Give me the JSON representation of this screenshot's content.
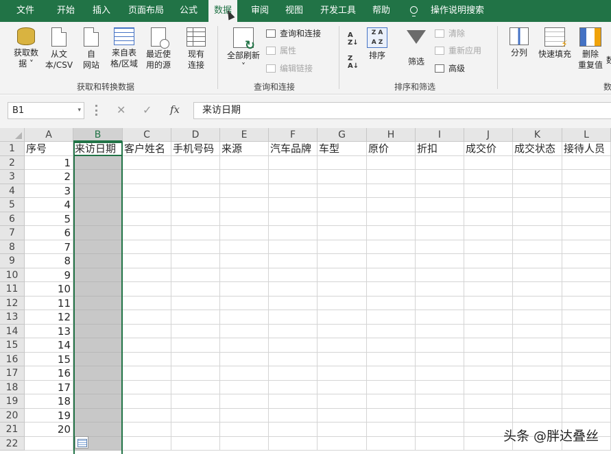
{
  "tabs": {
    "file": "文件",
    "home": "开始",
    "insert": "插入",
    "layout": "页面布局",
    "formulas": "公式",
    "data": "数据",
    "review": "审阅",
    "view": "视图",
    "developer": "开发工具",
    "help": "帮助",
    "tell_me": "操作说明搜索"
  },
  "ribbon": {
    "get_data_1": "获取数",
    "get_data_2": "据 ˅",
    "from_text_1": "从文",
    "from_text_2": "本/CSV",
    "from_web_1": "自",
    "from_web_2": "网站",
    "from_table_1": "来自表",
    "from_table_2": "格/区域",
    "recent_1": "最近使",
    "recent_2": "用的源",
    "existing_1": "现有",
    "existing_2": "连接",
    "refresh_all_1": "全部刷新",
    "refresh_all_2": "˅",
    "queries_connections": "查询和连接",
    "properties": "属性",
    "edit_links": "编辑链接",
    "sort": "排序",
    "filter": "筛选",
    "clear": "清除",
    "reapply": "重新应用",
    "advanced": "高级",
    "text_to_columns": "分列",
    "flash_fill": "快速填充",
    "remove_dup_1": "删除",
    "remove_dup_2": "重复值",
    "data_tools_partial": "数",
    "group_get_transform": "获取和转换数据",
    "group_queries": "查询和连接",
    "group_sort_filter": "排序和筛选"
  },
  "formula_bar": {
    "name_box": "B1",
    "name_dropdown": "▾",
    "cancel": "✕",
    "enter": "✓",
    "fx": "fx",
    "content": "来访日期"
  },
  "columns": [
    "A",
    "B",
    "C",
    "D",
    "E",
    "F",
    "G",
    "H",
    "I",
    "J",
    "K",
    "L"
  ],
  "headers": [
    "序号",
    "来访日期",
    "客户姓名",
    "手机号码",
    "来源",
    "汽车品牌",
    "车型",
    "原价",
    "折扣",
    "成交价",
    "成交状态",
    "接待人员"
  ],
  "row_numbers": [
    "1",
    "2",
    "3",
    "4",
    "5",
    "6",
    "7",
    "8",
    "9",
    "10",
    "11",
    "12",
    "13",
    "14",
    "15",
    "16",
    "17",
    "18",
    "19",
    "20",
    "21",
    "22"
  ],
  "seq_values": [
    "1",
    "2",
    "3",
    "4",
    "5",
    "6",
    "7",
    "8",
    "9",
    "10",
    "11",
    "12",
    "13",
    "14",
    "15",
    "16",
    "17",
    "18",
    "19",
    "20"
  ],
  "selected_column": "B",
  "watermark": "头条 @胖达叠丝"
}
